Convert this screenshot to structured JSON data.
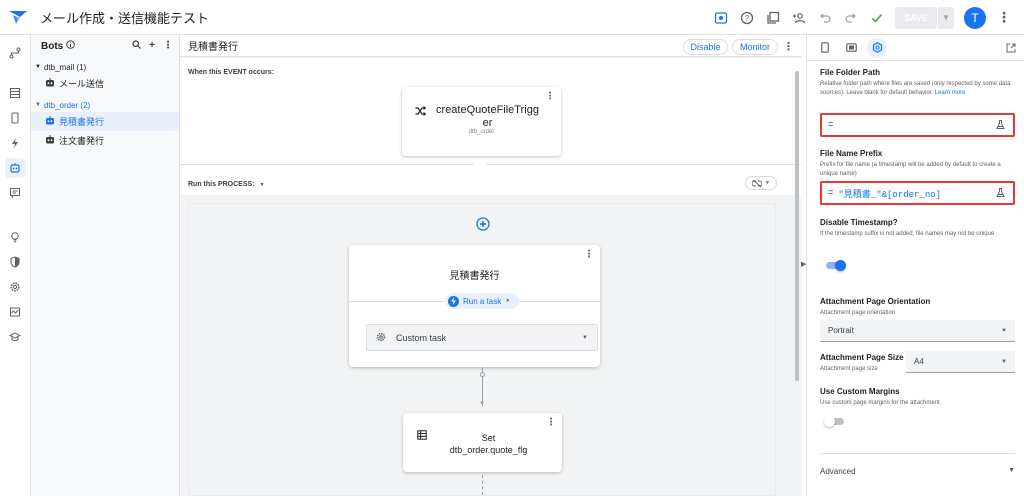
{
  "topbar": {
    "app_title": "メール作成・送信機能テスト",
    "save_label": "SAVE",
    "avatar_initial": "T"
  },
  "bots_panel": {
    "title": "Bots",
    "groups": [
      {
        "label": "dtb_mail (1)",
        "items": [
          "メール送信"
        ]
      },
      {
        "label": "dtb_order (2)",
        "items": [
          "見積書発行",
          "注文書発行"
        ]
      }
    ]
  },
  "canvas": {
    "bot_title": "見積書発行",
    "disable_label": "Disable",
    "monitor_label": "Monitor",
    "event_label": "When this EVENT occurs:",
    "event_name_line1": "createQuoteFileTrigg",
    "event_name_line2": "er",
    "event_table": "dtb_order",
    "process_label": "Run this PROCESS:",
    "step1_title": "見積書発行",
    "step1_badge": "Run a task",
    "step1_task": "Custom task",
    "step2_line1": "Set",
    "step2_line2": "dtb_order.quote_flg"
  },
  "settings": {
    "folder_title": "File Folder Path",
    "folder_desc": "Relative folder path where files are saved (only respected by some data sources). Leave blank for default behavior.",
    "folder_link": "Learn more",
    "folder_value": "=",
    "prefix_title": "File Name Prefix",
    "prefix_desc": "Prefix for file name (a timestamp will be added by default to create a unique name)",
    "prefix_eq": "=",
    "prefix_value": "\"見積書_\"&[order_no]",
    "timestamp_title": "Disable Timestamp?",
    "timestamp_desc": "If the timestamp suffix is not added, file names may not be unique",
    "timestamp_on": true,
    "orientation_title": "Attachment Page Orientation",
    "orientation_desc": "Attachment page orientation",
    "orientation_value": "Portrait",
    "size_title": "Attachment Page Size",
    "size_desc": "Attachment page size",
    "size_value": "A4",
    "margins_title": "Use Custom Margins",
    "margins_desc": "Use custom page margins for the attachment",
    "margins_on": false,
    "advanced_label": "Advanced"
  },
  "colors": {
    "accent": "#1a73e8",
    "highlight_border": "#e53935"
  }
}
